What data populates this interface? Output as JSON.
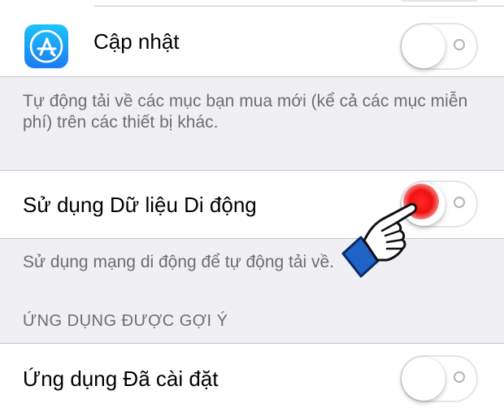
{
  "settings": {
    "top_partial_row": {
      "toggle_on": false
    },
    "updates": {
      "label": "Cập nhật",
      "icon": "app-store-icon",
      "toggle_on": false
    },
    "auto_download_footer": "Tự động tải về các mục bạn mua mới (kể cả các mục miễn phí) trên các thiết bị khác.",
    "cellular": {
      "label": "Sử dụng Dữ liệu Di động",
      "toggle_on": false,
      "footer": "Sử dụng mạng di động để tự động tải về."
    },
    "suggested_apps": {
      "header": "ỨNG DỤNG ĐƯỢC GỢI Ý",
      "installed_apps": {
        "label": "Ứng dụng Đã cài đặt",
        "toggle_on": false
      }
    }
  },
  "annotation": {
    "tap_indicator_color": "#f01010",
    "pointer_icon": "pointing-hand-icon"
  },
  "colors": {
    "background": "#efeff4",
    "cell": "#ffffff",
    "separator": "#c8c7cc",
    "secondary_text": "#6d6d72",
    "app_icon_top": "#1ec4fb",
    "app_icon_bottom": "#1b7cf2"
  }
}
